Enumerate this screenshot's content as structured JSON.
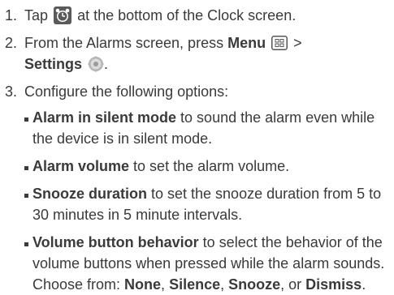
{
  "steps": [
    {
      "number": "1.",
      "before_icon": "Tap",
      "icon": "alarm-clock-icon",
      "after_icon": "at the bottom of the Clock screen."
    },
    {
      "number": "2.",
      "before_bold": "From the Alarms screen, press",
      "menu_label": "Menu",
      "menu_icon": "menu-key-icon",
      "separator": ">",
      "settings_label": "Settings",
      "settings_icon": "gear-icon",
      "end": "."
    },
    {
      "number": "3.",
      "text": "Configure the following options:"
    }
  ],
  "options": [
    {
      "title": "Alarm in silent mode",
      "description": " to sound the alarm even while the device is in silent mode."
    },
    {
      "title": "Alarm volume",
      "description": " to set the alarm volume."
    },
    {
      "title": "Snooze duration",
      "description": " to set the snooze duration from 5 to 30 minutes in 5 minute intervals."
    },
    {
      "title": "Volume button behavior",
      "description": " to select the behavior of the volume buttons when pressed while the alarm sounds. Choose from: ",
      "choices": [
        "None",
        "Silence",
        "Snooze",
        "Dismiss"
      ],
      "choice_sep_1": ", ",
      "choice_sep_2": ", ",
      "choice_sep_3": ", or ",
      "end": "."
    }
  ],
  "colors": {
    "text": "#3a3a3a",
    "icon_dark": "#555555",
    "icon_light": "#bdbdbd"
  }
}
